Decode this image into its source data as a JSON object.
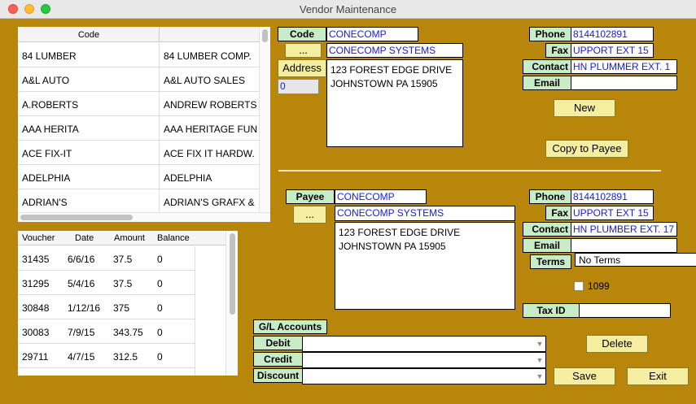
{
  "window": {
    "title": "Vendor Maintenance",
    "colors": {
      "background": "#b8860b",
      "label_bg": "#c8ecc8",
      "button_bg": "#f5eea0",
      "field_text": "#1a1ae0"
    }
  },
  "vendor_list": {
    "headers": [
      "Code",
      ""
    ],
    "rows": [
      [
        "84 LUMBER",
        "84 LUMBER COMP."
      ],
      [
        "A&L AUTO",
        "A&L AUTO SALES"
      ],
      [
        "A.ROBERTS",
        "ANDREW ROBERTS"
      ],
      [
        "AAA HERITA",
        "AAA HERITAGE FUN"
      ],
      [
        "ACE FIX-IT",
        "ACE FIX IT HARDW."
      ],
      [
        "ADELPHIA",
        "ADELPHIA"
      ],
      [
        "ADRIAN'S",
        "ADRIAN'S GRAFX &"
      ]
    ]
  },
  "voucher_list": {
    "headers": [
      "Voucher",
      "Date",
      "Amount",
      "Balance"
    ],
    "rows": [
      [
        "31435",
        "6/6/16",
        "37.5",
        "0"
      ],
      [
        "31295",
        "5/4/16",
        "37.5",
        "0"
      ],
      [
        "30848",
        "1/12/16",
        "375",
        "0"
      ],
      [
        "30083",
        "7/9/15",
        "343.75",
        "0"
      ],
      [
        "29711",
        "4/7/15",
        "312.5",
        "0"
      ]
    ]
  },
  "vendor": {
    "code_label": "Code",
    "code": "CONECOMP",
    "lookup_label": "...",
    "name": "CONECOMP SYSTEMS",
    "address_label": "Address",
    "address_line1": "123 FOREST EDGE DRIVE",
    "address_line2": "JOHNSTOWN PA 15905",
    "address_count": "0",
    "phone_label": "Phone",
    "phone": "8144102891",
    "fax_label": "Fax",
    "fax": "UPPORT EXT 15",
    "contact_label": "Contact",
    "contact": "HN PLUMMER EXT. 1",
    "email_label": "Email",
    "email": "",
    "new_label": "New",
    "copy_label": "Copy to Payee"
  },
  "payee": {
    "payee_label": "Payee",
    "code": "CONECOMP",
    "lookup_label": "...",
    "name": "CONECOMP SYSTEMS",
    "address_line1": "123 FOREST EDGE DRIVE",
    "address_line2": "JOHNSTOWN PA 15905",
    "phone_label": "Phone",
    "phone": "8144102891",
    "fax_label": "Fax",
    "fax": "UPPORT EXT 15",
    "contact_label": "Contact",
    "contact": "HN PLUMBER EXT. 17",
    "email_label": "Email",
    "email": "",
    "terms_label": "Terms",
    "terms": "No Terms",
    "checkbox_label": "1099",
    "checkbox_checked": false,
    "taxid_label": "Tax ID",
    "taxid": ""
  },
  "gl": {
    "header": "G/L Accounts",
    "debit_label": "Debit",
    "credit_label": "Credit",
    "discount_label": "Discount",
    "debit": "",
    "credit": "",
    "discount": ""
  },
  "actions": {
    "delete_label": "Delete",
    "save_label": "Save",
    "exit_label": "Exit"
  }
}
